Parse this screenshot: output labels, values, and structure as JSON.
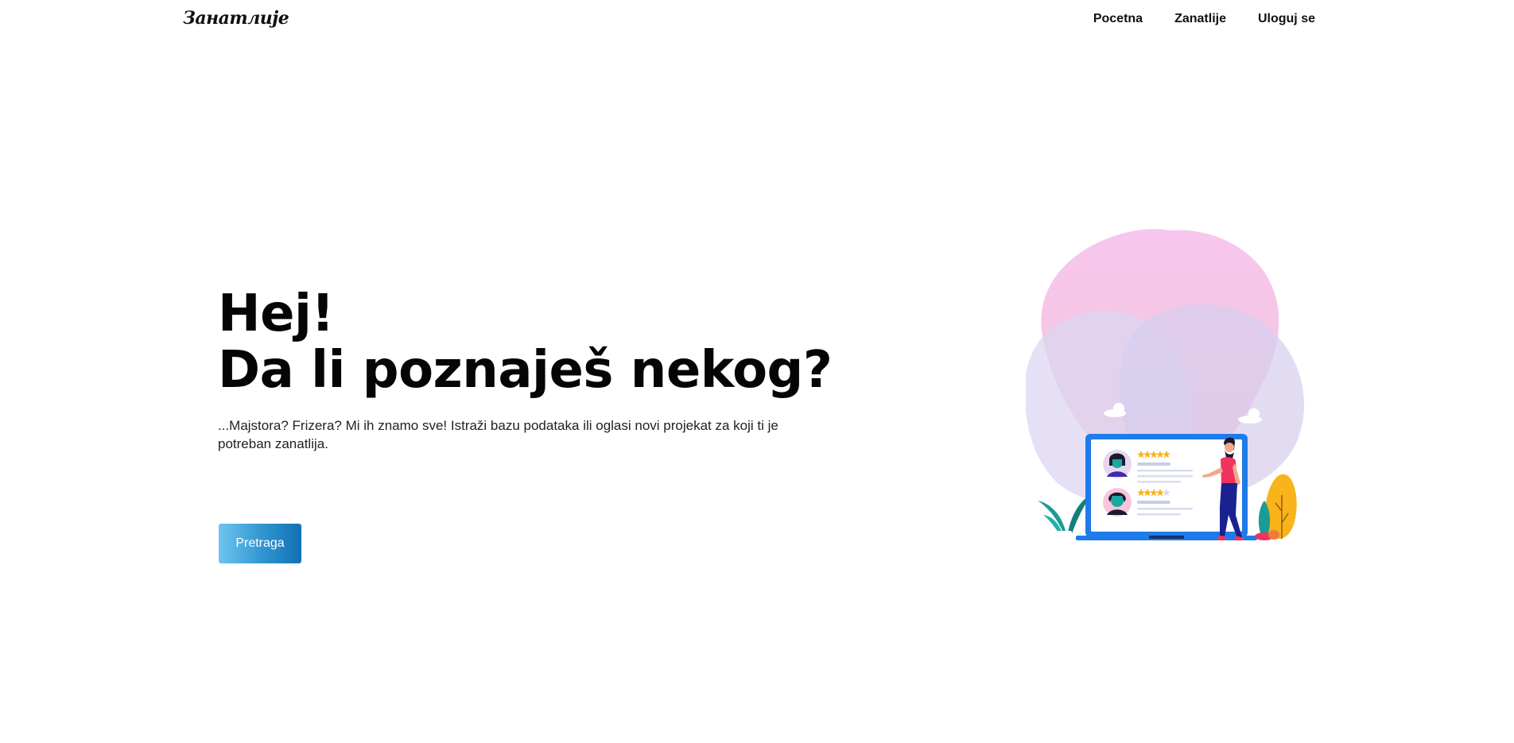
{
  "navbar": {
    "brand": "Занатлије",
    "links": [
      {
        "label": "Pocetna"
      },
      {
        "label": "Zanatlije"
      },
      {
        "label": "Uloguj se"
      }
    ]
  },
  "hero": {
    "title_line1": "Hej!",
    "title_line2": "Da li poznaješ nekog?",
    "subtitle": "...Majstora? Frizera? Mi ih znamo sve! Istraži bazu podataka ili oglasi novi projekat za koji ti je potreban zanatlija.",
    "button_label": "Pretraga"
  },
  "colors": {
    "button_gradient_start": "#6ec4ee",
    "button_gradient_end": "#1071b4",
    "blob_pink": "#f7c6ef",
    "blob_lavender": "#dcd6f2",
    "laptop_blue": "#1e7ce8",
    "person_shirt": "#f0335f",
    "person_pants": "#1c2190",
    "plant_yellow": "#f8b41a",
    "plant_teal": "#1a9c95"
  },
  "illustration": {
    "icon": "review-laptop-illustration",
    "reviews": [
      {
        "stars": 5
      },
      {
        "stars": 4
      }
    ]
  }
}
